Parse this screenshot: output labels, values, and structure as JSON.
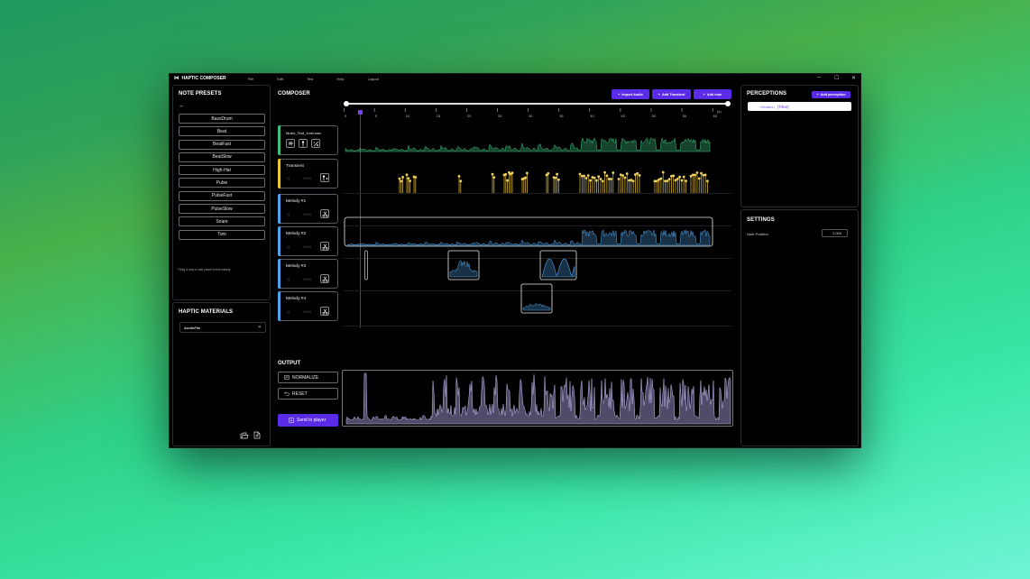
{
  "titlebar": {
    "logo": "⋈",
    "app_name": "HAPTIC COMPOSER",
    "menu": [
      "File",
      "Edit",
      "Test",
      "Help",
      "Logout"
    ],
    "min": "─",
    "max": "☐",
    "close": "✕"
  },
  "presets": {
    "title": "NOTE PRESETS",
    "back": "←",
    "items": [
      "BassDrum",
      "Beat",
      "BeatFast",
      "BeatSlow",
      "High-Hat",
      "Pulse",
      "PulseFast",
      "PulseSlow",
      "Snare",
      "Tom"
    ],
    "hint": "*Drag & drop to add preset to this melody"
  },
  "materials": {
    "title": "HAPTIC MATERIALS",
    "item": "AudioFile",
    "remove": "✕"
  },
  "composer": {
    "title": "COMPOSER",
    "buttons": {
      "import_audio": "Import Audio",
      "add_transient": "Add Transient",
      "add_note": "Add note"
    },
    "plus": "+",
    "ruler_ticks": [
      "0",
      "5",
      "10",
      "15",
      "20",
      "25",
      "30",
      "35",
      "40",
      "45",
      "50",
      "55",
      "60"
    ],
    "ruler_unit": "(s)",
    "playhead_fraction": 0.043,
    "tracks": [
      {
        "name": "Music_Test_1min.wav",
        "color": "#3fbf7f"
      },
      {
        "name": "Transient",
        "color": "#e8c43a",
        "mute": "◁)",
        "volume": "100%"
      },
      {
        "name": "Melody #1",
        "color": "#4fa3e8",
        "mute": "◁)",
        "volume": "100%"
      },
      {
        "name": "Melody #2",
        "color": "#4fa3e8",
        "mute": "◁)",
        "volume": "100%"
      },
      {
        "name": "Melody #3",
        "color": "#4fa3e8",
        "mute": "◁)",
        "volume": "100%"
      },
      {
        "name": "Melody #4",
        "color": "#4fa3e8",
        "mute": "◁)",
        "volume": "100%"
      }
    ]
  },
  "output": {
    "title": "OUTPUT",
    "normalize": "NORMALIZE",
    "reset": "RESET",
    "send": "Send to player"
  },
  "perceptions": {
    "title": "PERCEPTIONS",
    "add": "Add perception",
    "item_label": "Vibration",
    "item_value": "(Time)"
  },
  "settings": {
    "title": "SETTINGS",
    "note_position_label": "Note Position",
    "note_position_value": "1.000"
  },
  "colors": {
    "accent": "#5b2ce8",
    "audio": "#3fbf7f",
    "transient": "#e8c43a",
    "melody": "#4fa3e8",
    "output": "#b2a6e6"
  }
}
